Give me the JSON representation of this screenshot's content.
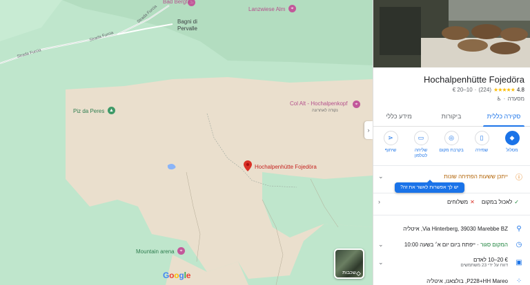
{
  "map": {
    "pois": {
      "bad_bergfall": "Bad Bergfall",
      "lanzwiese_alm": "Lanzwiese Alm",
      "bagni_di_pervalle": "Bagni di\nPervalle",
      "piz_da_peres": "Piz da Peres",
      "col_alt": "Col Alt - Hochalpenkopf",
      "col_alt_sub": "נקודה לאחרונה",
      "mountain_arena": "Mountain arena",
      "pin_label": "Hochalpenhütte Fojedöra"
    },
    "roads": [
      "Strada Furcia",
      "Strada Furcia",
      "Strada Furcia"
    ],
    "layers_label": "שכבות",
    "google_letters": [
      "G",
      "o",
      "o",
      "g",
      "l",
      "e"
    ],
    "colors": {
      "forest": "#bfe6cc",
      "bare": "#eadfcd",
      "pin": "#d93025"
    }
  },
  "panel": {
    "title": "Hochalpenhütte Fojedöra",
    "rating": "4.8",
    "stars": "★★★★★",
    "reviews": "(224)",
    "price": "€ 20–10",
    "category": "מסעדה",
    "category_icon": "accessible-icon",
    "tabs": [
      "סקירה כללית",
      "ביקורות",
      "מידע כללי"
    ],
    "actions": [
      {
        "label": "מסלול",
        "icon": "directions-icon"
      },
      {
        "label": "שמירה",
        "icon": "bookmark-icon"
      },
      {
        "label": "בקרבת מקום",
        "icon": "nearby-icon"
      },
      {
        "label": "שליחה\nלטלפון",
        "icon": "send-to-phone-icon"
      },
      {
        "label": "שיתוף",
        "icon": "share-icon"
      }
    ],
    "warning": "ייתכן ששעות הפתיחה שונות",
    "tooltip": "יש לך אפשרות לאשר את זה?",
    "amenities": {
      "dine_in": "לאכול במקום",
      "delivery": "משלוחים"
    },
    "address": "Via Hinterberg, 39030 Marebbe BZ, איטליה",
    "hours_status": "המקום סגור",
    "hours_detail": "· ייפתח ביום יום א׳ בשעה 10:00",
    "price_line": "€ 20–10 לאדם",
    "price_sub": "דווח על ידי 23 משתמשים",
    "plus_code": "P228+HH Mareo, בולצאנו, איטליה"
  }
}
